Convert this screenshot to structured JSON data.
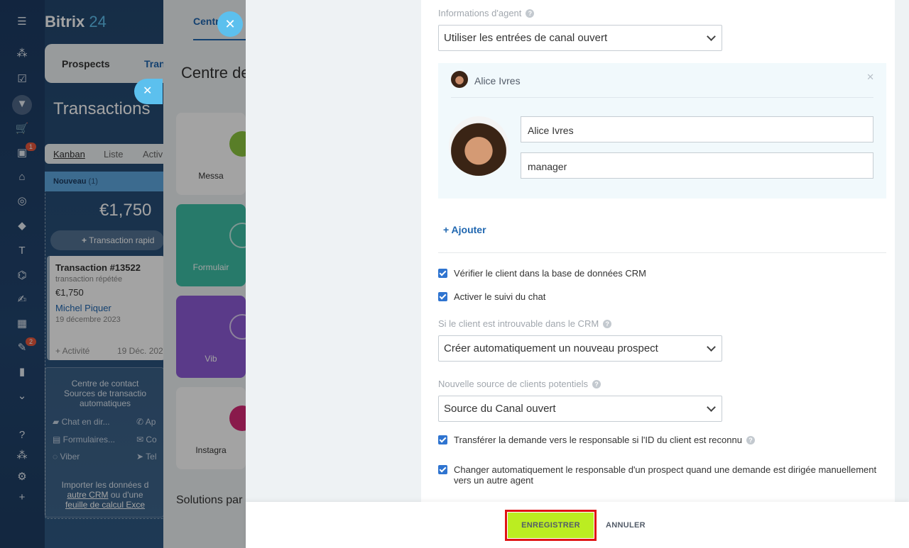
{
  "app": {
    "brand": "Bitrix",
    "brand_num": "24"
  },
  "rail": {
    "badge_contacts": "1",
    "badge_tasks": "2"
  },
  "crm": {
    "tab_prospects": "Prospects",
    "tab_transactions": "Tran",
    "title": "Transactions",
    "view_kanban": "Kanban",
    "view_list": "Liste",
    "view_activities": "Activ",
    "column_title": "Nouveau",
    "column_count": "(1)",
    "column_sum": "€1,750",
    "quick_add": "Transaction rapid",
    "deal": {
      "title": "Transaction #13522",
      "subtitle": "transaction répétée",
      "amount": "€1,750",
      "contact": "Michel Piquer",
      "date": "19 décembre 2023",
      "activity": "+ Activité",
      "activity_date": "19 Déc. 202"
    },
    "contact_center": {
      "line1": "Centre de contact",
      "line2": "Sources de transactio",
      "line3": "automatiques",
      "chat": "Chat en dir...",
      "calls": "Ap",
      "forms": "Formulaires...",
      "email": "Co",
      "viber": "Viber",
      "telegram": "Tel",
      "import1": "Importer les données d",
      "import2_link": "autre CRM",
      "import2_rest": " ou d'une",
      "import3": "feuille de calcul Exce"
    }
  },
  "middle": {
    "tab": "Centr",
    "title": "Centre de",
    "tile_messages": "Messa",
    "tile_forms": "Formulair",
    "tile_viber": "Vib",
    "tile_instagram": "Instagra",
    "solutions": "Solutions par"
  },
  "settings": {
    "agent_info_label": "Informations d'agent",
    "agent_info_value": "Utiliser les entrées de canal ouvert",
    "agent_name_header": "Alice Ivres",
    "agent_name_value": "Alice Ivres",
    "agent_role_value": "manager",
    "add_label": "+ Ajouter",
    "check_crm": "Vérifier le client dans la base de données CRM",
    "check_tracking": "Activer le suivi du chat",
    "not_found_label": "Si le client est introuvable dans le CRM",
    "not_found_value": "Créer automatiquement un nouveau prospect",
    "lead_source_label": "Nouvelle source de clients potentiels",
    "lead_source_value": "Source du Canal ouvert",
    "check_transfer": "Transférer la demande vers le responsable si l'ID du client est reconnu",
    "check_change_line1": "Changer automatiquement le responsable d'un prospect quand une demande est dirigée manuellement",
    "check_change_line2": "vers un autre agent"
  },
  "footer": {
    "save": "ENREGISTRER",
    "cancel": "ANNULER"
  },
  "colors": {
    "accent_blue": "#2067b0",
    "save_green": "#bbed21",
    "highlight_red": "#e01414",
    "checkbox_blue": "#2f74d0"
  }
}
